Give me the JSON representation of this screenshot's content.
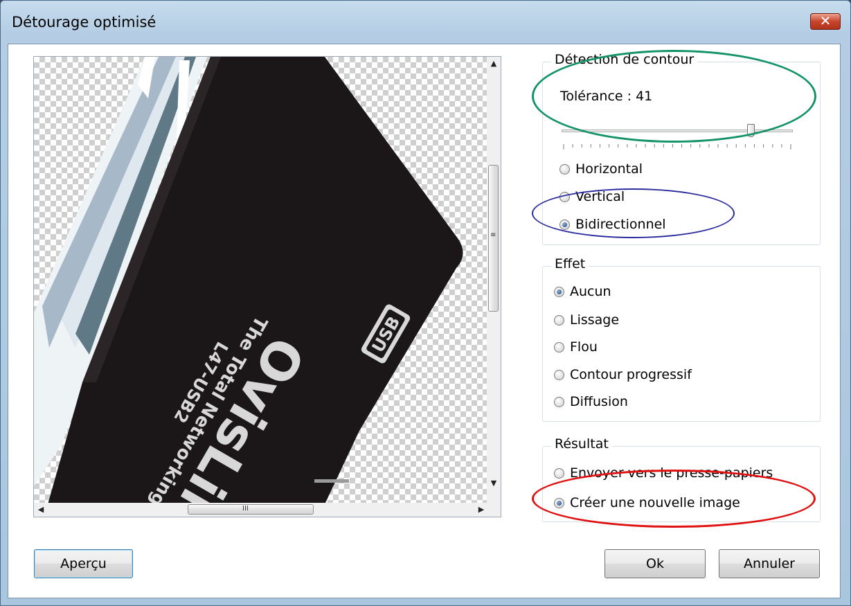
{
  "window": {
    "title": "Détourage optimisé",
    "close_symbol": "✕"
  },
  "preview": {
    "artwork_text": {
      "brand": "OvisLin",
      "tagline": "The Total Networking Solu",
      "model": "L47-USB2",
      "port": "USB"
    },
    "scroll_grip": "≡",
    "hscroll_grip": "III"
  },
  "edge_detection": {
    "group_label": "Détection de contour",
    "tolerance_label": "Tolérance : 41",
    "tolerance_value": 41,
    "tolerance_max": 50,
    "options": [
      {
        "label": "Horizontal",
        "checked": false
      },
      {
        "label": "Vertical",
        "checked": false
      },
      {
        "label": "Bidirectionnel",
        "checked": true
      }
    ]
  },
  "effect": {
    "group_label": "Effet",
    "options": [
      {
        "label": "Aucun",
        "checked": true
      },
      {
        "label": "Lissage",
        "checked": false
      },
      {
        "label": "Flou",
        "checked": false
      },
      {
        "label": "Contour progressif",
        "checked": false
      },
      {
        "label": "Diffusion",
        "checked": false
      }
    ]
  },
  "result": {
    "group_label": "Résultat",
    "options": [
      {
        "label": "Envoyer vers le presse-papiers",
        "checked": false
      },
      {
        "label": "Créer une nouvelle image",
        "checked": true
      }
    ]
  },
  "buttons": {
    "preview": "Aperçu",
    "ok": "Ok",
    "cancel": "Annuler"
  },
  "annotations": {
    "green": "#14936a",
    "blue": "#2a2a9e",
    "red": "#e01010"
  }
}
